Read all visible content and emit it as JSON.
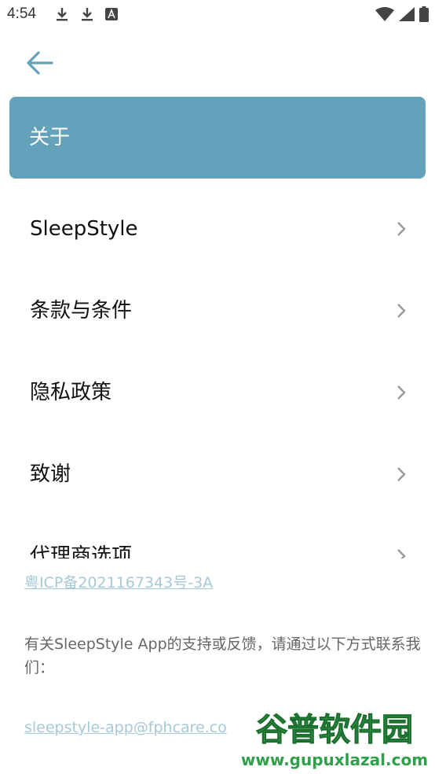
{
  "status_bar": {
    "time": "4:54",
    "left_icons": [
      "download-icon",
      "download-icon",
      "font-app-icon"
    ],
    "right_icons": [
      "wifi-icon",
      "cell-signal-icon",
      "battery-icon"
    ]
  },
  "nav": {
    "back_icon": "arrow-left-icon"
  },
  "header": {
    "title": "关于"
  },
  "menu": {
    "items": [
      {
        "label": "SleepStyle"
      },
      {
        "label": "条款与条件"
      },
      {
        "label": "隐私政策"
      },
      {
        "label": "致谢"
      },
      {
        "label": "代理商选项"
      }
    ]
  },
  "footer": {
    "icp": "粤ICP备2021167343号-3A",
    "support_text": "有关SleepStyle App的支持或反馈，请通过以下方式联系我们：",
    "email": "sleepstyle-app@fphcare.co"
  },
  "watermark": {
    "title": "谷普软件园",
    "url": "www.gupuxlazal.com"
  },
  "colors": {
    "accent": "#64a1bb",
    "link": "#a6c9d8",
    "watermark_green": "#2fa04a"
  }
}
